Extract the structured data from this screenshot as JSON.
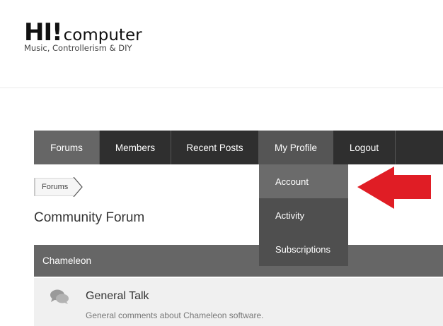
{
  "site": {
    "logo_hi": "HI!",
    "logo_text": "computer",
    "tagline": "Music, Controllerism & DIY"
  },
  "nav": {
    "items": [
      {
        "label": "Forums"
      },
      {
        "label": "Members"
      },
      {
        "label": "Recent Posts"
      },
      {
        "label": "My Profile"
      },
      {
        "label": "Logout"
      }
    ],
    "profile_menu": [
      {
        "label": "Account"
      },
      {
        "label": "Activity"
      },
      {
        "label": "Subscriptions"
      }
    ]
  },
  "breadcrumb": {
    "items": [
      "Forums"
    ]
  },
  "page": {
    "title": "Community Forum"
  },
  "section": {
    "title": "Chameleon"
  },
  "forums": [
    {
      "name": "General Talk",
      "description": "General comments about Chameleon software.",
      "icon": "chat-bubbles-icon"
    }
  ],
  "colors": {
    "nav_bg": "#2f2f2f",
    "nav_active": "#666666",
    "dropdown_bg": "#4f4f4f",
    "dropdown_hover": "#6b6b6b",
    "arrow": "#e01d25"
  }
}
